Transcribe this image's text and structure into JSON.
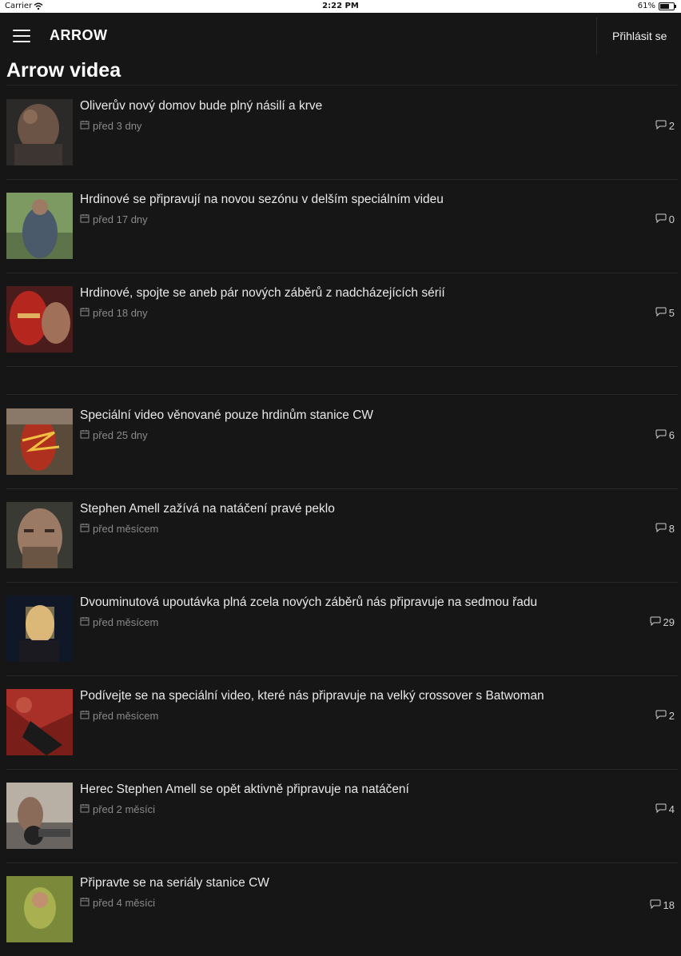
{
  "status_bar": {
    "carrier": "Carrier",
    "time": "2:22 PM",
    "battery": "61%"
  },
  "header": {
    "app_title": "ARROW",
    "login_label": "Přihlásit se"
  },
  "page": {
    "title": "Arrow videa"
  },
  "colors": {
    "background": "#161617",
    "text": "#e9e9e9",
    "muted": "#8a8a8a"
  },
  "articles": [
    {
      "title": "Oliverův nový domov bude plný násilí a krve",
      "date": "před 3 dny",
      "comments": "2"
    },
    {
      "title": "Hrdinové se připravují na novou sezónu v delším speciálním videu",
      "date": "před 17 dny",
      "comments": "0"
    },
    {
      "title": "Hrdinové, spojte se aneb pár nových záběrů z nadcházejících sérií",
      "date": "před 18 dny",
      "comments": "5"
    },
    {
      "title": "Speciální video věnované pouze hrdinům stanice CW",
      "date": "před 25 dny",
      "comments": "6"
    },
    {
      "title": "Stephen Amell zažívá na natáčení pravé peklo",
      "date": "před měsícem",
      "comments": "8"
    },
    {
      "title": "Dvouminutová upoutávka plná zcela nových záběrů nás připravuje na sedmou řadu",
      "date": "před měsícem",
      "comments": "29"
    },
    {
      "title": "Podívejte se na speciální video, které nás připravuje na velký crossover s Batwoman",
      "date": "před měsícem",
      "comments": "2"
    },
    {
      "title": "Herec Stephen Amell se opět aktivně připravuje na natáčení",
      "date": "před 2 měsíci",
      "comments": "4"
    },
    {
      "title": "Připravte se na seriály stanice CW",
      "date": "před 4 měsíci",
      "comments": "18"
    }
  ]
}
